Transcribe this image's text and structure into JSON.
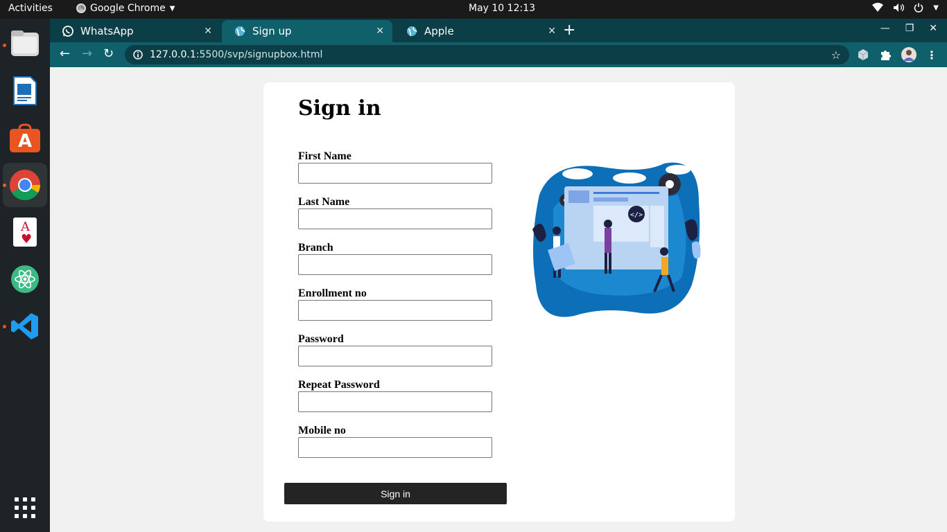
{
  "topbar": {
    "activities": "Activities",
    "app_name": "Google Chrome",
    "clock": "May 10  12:13"
  },
  "tabs": [
    {
      "label": "WhatsApp",
      "icon": "whatsapp-icon"
    },
    {
      "label": "Sign up",
      "icon": "globe-icon",
      "active": true
    },
    {
      "label": "Apple",
      "icon": "globe-icon"
    }
  ],
  "omnibox": {
    "host": "127.0.0.1",
    "path": ":5500/svp/signupbox.html"
  },
  "form": {
    "title": "Sign in",
    "fields": [
      {
        "label": "First Name"
      },
      {
        "label": "Last Name"
      },
      {
        "label": "Branch"
      },
      {
        "label": "Enrollment no"
      },
      {
        "label": "Password"
      },
      {
        "label": "Repeat Password"
      },
      {
        "label": "Mobile no"
      }
    ],
    "submit_label": "Sign in"
  },
  "colors": {
    "tabstrip": "#0b3e46",
    "toolbar": "#10606c",
    "submit": "#242424"
  }
}
